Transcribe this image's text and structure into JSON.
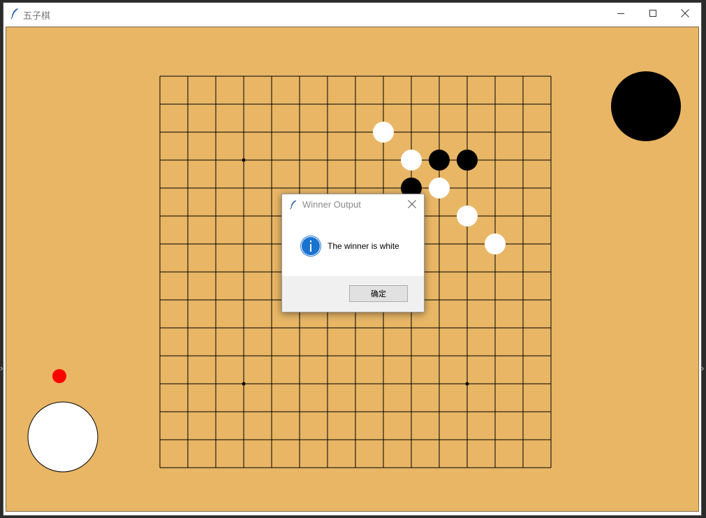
{
  "window": {
    "title": "五子棋",
    "controls": [
      "minimize-icon",
      "maximize-icon",
      "close-icon"
    ]
  },
  "board": {
    "size": 15,
    "background_color": "#e8b665",
    "line_color": "#000000",
    "star_points": [
      [
        3,
        3
      ],
      [
        3,
        11
      ],
      [
        11,
        11
      ]
    ],
    "stones": [
      {
        "col": 8,
        "row": 2,
        "color": "white"
      },
      {
        "col": 9,
        "row": 3,
        "color": "white"
      },
      {
        "col": 10,
        "row": 3,
        "color": "black"
      },
      {
        "col": 11,
        "row": 3,
        "color": "black"
      },
      {
        "col": 9,
        "row": 4,
        "color": "black"
      },
      {
        "col": 10,
        "row": 4,
        "color": "white"
      },
      {
        "col": 11,
        "row": 5,
        "color": "white"
      },
      {
        "col": 12,
        "row": 6,
        "color": "white"
      }
    ]
  },
  "indicators": {
    "black_player_stone": "black",
    "white_player_stone": "white",
    "turn_marker_color": "#ff0000"
  },
  "dialog": {
    "title": "Winner Output",
    "message": "The winner is white",
    "ok_label": "确定",
    "info_icon": "info-icon"
  }
}
